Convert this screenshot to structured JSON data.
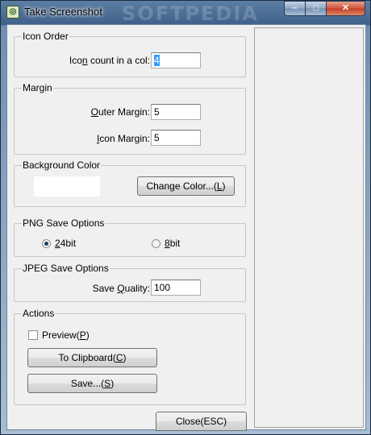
{
  "window": {
    "title": "Take Screenshot",
    "watermark": "SOFTPEDIA",
    "minimize_glyph": "–",
    "maximize_glyph": "□",
    "close_glyph": "✕",
    "icon": "app-icon"
  },
  "icon_order": {
    "legend": "Icon Order",
    "count_label_pre": "Ico",
    "count_label_ul": "n",
    "count_label_post": " count in a col:",
    "count_value": "4"
  },
  "margin": {
    "legend": "Margin",
    "outer_ul": "O",
    "outer_rest": "uter Margin:",
    "outer_value": "5",
    "icon_ul": "I",
    "icon_rest": "con Margin:",
    "icon_value": "5"
  },
  "background_color": {
    "legend": "Background Color",
    "swatch_color": "#ffffff",
    "change_pre": "Change Color...(",
    "change_ul": "L",
    "change_post": ")"
  },
  "png": {
    "legend": "PNG Save Options",
    "opt24_ul": "2",
    "opt24_rest": "4bit",
    "opt8_ul": "8",
    "opt8_rest": "bit",
    "selected": "24bit"
  },
  "jpeg": {
    "legend": "JPEG Save Options",
    "quality_pre": "Save ",
    "quality_ul": "Q",
    "quality_post": "uality:",
    "quality_value": "100"
  },
  "actions": {
    "legend": "Actions",
    "preview_pre": "Preview(",
    "preview_ul": "P",
    "preview_post": ")",
    "preview_checked": false,
    "clipboard_pre": "To Clipboard(",
    "clipboard_ul": "C",
    "clipboard_post": ")",
    "save_pre": "Save...(",
    "save_ul": "S",
    "save_post": ")"
  },
  "close_button": "Close(ESC)"
}
